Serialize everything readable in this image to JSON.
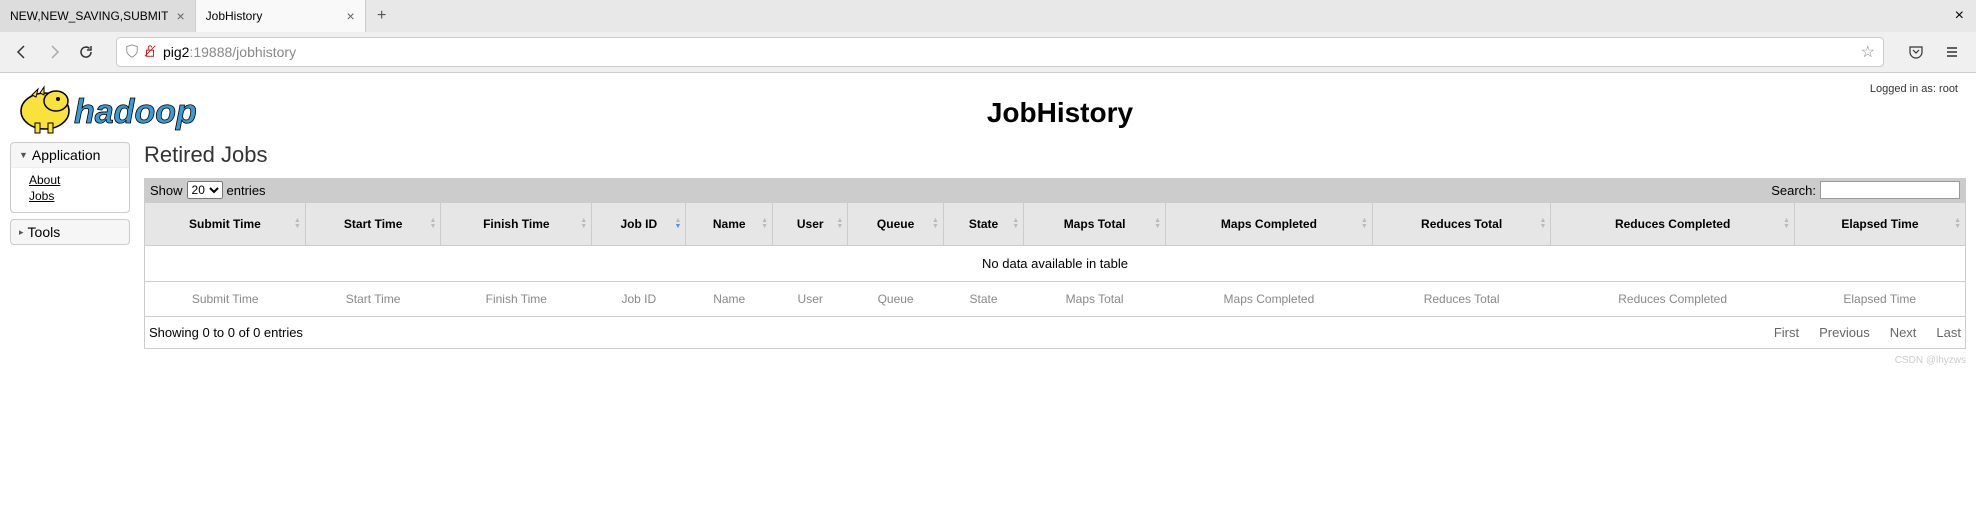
{
  "browser": {
    "tabs": [
      {
        "title": "NEW,NEW_SAVING,SUBMIT",
        "active": false
      },
      {
        "title": "JobHistory",
        "active": true
      }
    ],
    "url_domain": "pig2",
    "url_path": ":19888/jobhistory"
  },
  "login_label": "Logged in as: root",
  "page_title": "JobHistory",
  "sidebar": {
    "app_header": "Application",
    "about": "About",
    "jobs": "Jobs",
    "tools_header": "Tools"
  },
  "section": {
    "title": "Retired Jobs"
  },
  "datatable": {
    "show_label": "Show",
    "entries_label": "entries",
    "page_size": "20",
    "search_label": "Search:",
    "search_value": "",
    "columns": [
      "Submit Time",
      "Start Time",
      "Finish Time",
      "Job ID",
      "Name",
      "User",
      "Queue",
      "State",
      "Maps Total",
      "Maps Completed",
      "Reduces Total",
      "Reduces Completed",
      "Elapsed Time"
    ],
    "empty_message": "No data available in table",
    "info": "Showing 0 to 0 of 0 entries",
    "paging": {
      "first": "First",
      "previous": "Previous",
      "next": "Next",
      "last": "Last"
    }
  },
  "watermark": "CSDN @lhyzws"
}
